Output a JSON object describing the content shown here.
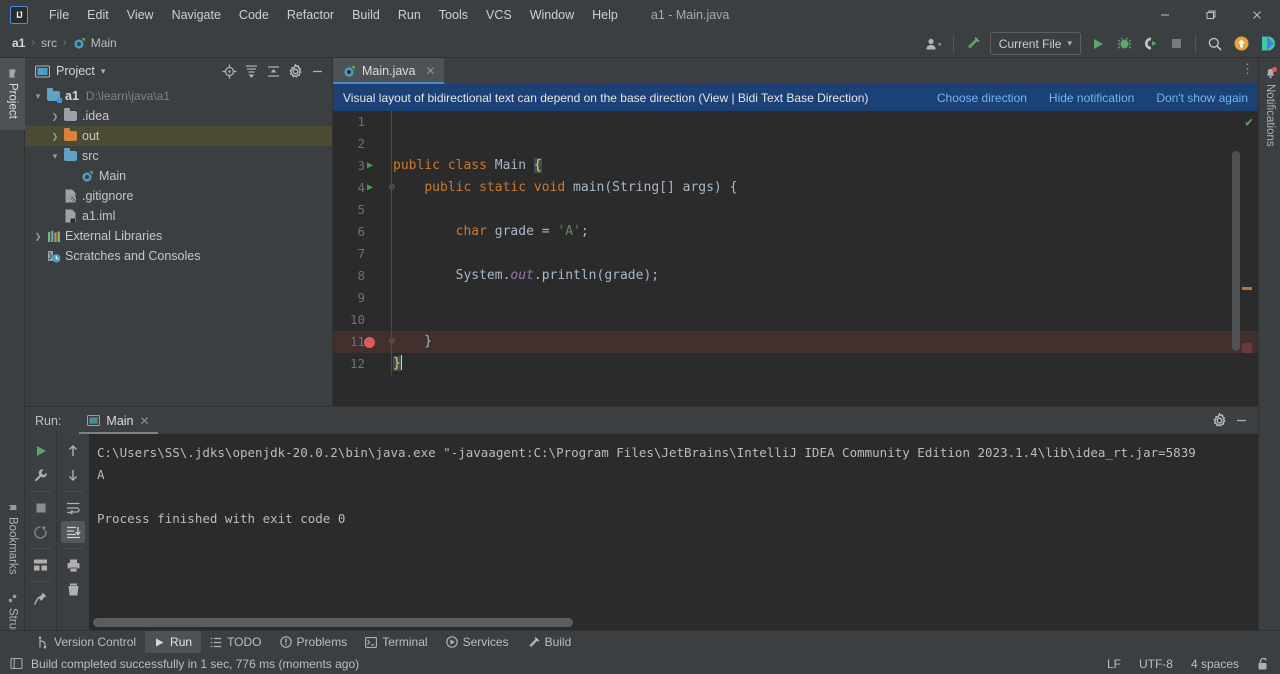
{
  "window": {
    "title": "a1 - Main.java",
    "logo_text": "IJ",
    "minimize": "—",
    "maximize": "❐",
    "close": "✕"
  },
  "menu": {
    "items": [
      {
        "label": "File"
      },
      {
        "label": "Edit"
      },
      {
        "label": "View"
      },
      {
        "label": "Navigate"
      },
      {
        "label": "Code"
      },
      {
        "label": "Refactor"
      },
      {
        "label": "Build"
      },
      {
        "label": "Run"
      },
      {
        "label": "Tools"
      },
      {
        "label": "VCS"
      },
      {
        "label": "Window"
      },
      {
        "label": "Help"
      }
    ]
  },
  "navbar": {
    "crumbs": [
      "a1",
      "src",
      "Main"
    ],
    "separator": "›",
    "run_config": "Current File",
    "chevron": "▾",
    "icons": {
      "account": "account-icon",
      "build_hammer": "build-hammer-icon",
      "run": "run-icon",
      "debug": "debug-icon",
      "run_coverage": "run-with-coverage-icon",
      "stop": "stop-icon",
      "search": "search-icon",
      "update": "update-icon",
      "ide_assistant": "ide-assistant-icon"
    }
  },
  "left_strip": {
    "tabs": [
      {
        "label": "Project",
        "active": true
      },
      {
        "label": "Bookmarks",
        "active": false
      },
      {
        "label": "Structure",
        "active": false
      }
    ]
  },
  "right_strip": {
    "tabs": [
      {
        "label": "Notifications",
        "has_badge": true
      }
    ]
  },
  "project_panel": {
    "title": "Project",
    "dropdown": "▾",
    "actions": [
      "locate-icon",
      "expand-all-icon",
      "collapse-all-icon",
      "settings-icon",
      "hide-icon"
    ],
    "tree": [
      {
        "label": "a1",
        "path": "D:\\learn\\java\\a1",
        "icon": "module-folder",
        "arrow": "open",
        "indent": 0,
        "bold": true
      },
      {
        "label": ".idea",
        "path": "",
        "icon": "folder-grey",
        "arrow": "closed",
        "indent": 1,
        "bold": false
      },
      {
        "label": "out",
        "path": "",
        "icon": "folder-orange",
        "arrow": "closed",
        "indent": 1,
        "bold": false,
        "selected": true
      },
      {
        "label": "src",
        "path": "",
        "icon": "folder-blue",
        "arrow": "open",
        "indent": 1,
        "bold": false
      },
      {
        "label": "Main",
        "path": "",
        "icon": "java-class",
        "arrow": "none",
        "indent": 2,
        "bold": false
      },
      {
        "label": ".gitignore",
        "path": "",
        "icon": "gitignore-file",
        "arrow": "none",
        "indent": 1,
        "bold": false
      },
      {
        "label": "a1.iml",
        "path": "",
        "icon": "iml-file",
        "arrow": "none",
        "indent": 1,
        "bold": false
      },
      {
        "label": "External Libraries",
        "path": "",
        "icon": "libraries",
        "arrow": "closed",
        "indent": 0,
        "bold": false
      },
      {
        "label": "Scratches and Consoles",
        "path": "",
        "icon": "scratches",
        "arrow": "none",
        "indent": 0,
        "bold": false
      }
    ]
  },
  "editor": {
    "tab": {
      "label": "Main.java",
      "icon": "java-class-icon",
      "close": "✕"
    },
    "more_actions": "⋮",
    "notification": {
      "message": "Visual layout of bidirectional text can depend on the base direction (View | Bidi Text Base Direction)",
      "links": [
        "Choose direction",
        "Hide notification",
        "Don't show again"
      ]
    },
    "inspection_status": "✔",
    "lines": [
      {
        "num": "1",
        "tokens": []
      },
      {
        "num": "2",
        "tokens": []
      },
      {
        "num": "3",
        "run_marker": true,
        "tokens": [
          {
            "t": "public",
            "c": "k"
          },
          {
            "t": " ",
            "c": "punc"
          },
          {
            "t": "class",
            "c": "k"
          },
          {
            "t": " Main ",
            "c": "cls"
          },
          {
            "t": "{",
            "c": "brace-hl"
          }
        ]
      },
      {
        "num": "4",
        "run_marker": true,
        "fold": true,
        "tokens": [
          {
            "t": "    ",
            "c": "punc"
          },
          {
            "t": "public",
            "c": "k"
          },
          {
            "t": " ",
            "c": "punc"
          },
          {
            "t": "static",
            "c": "k"
          },
          {
            "t": " ",
            "c": "punc"
          },
          {
            "t": "void",
            "c": "k"
          },
          {
            "t": " ",
            "c": "punc"
          },
          {
            "t": "main",
            "c": "cls"
          },
          {
            "t": "(String[] args) {",
            "c": "punc"
          }
        ]
      },
      {
        "num": "5",
        "tokens": []
      },
      {
        "num": "6",
        "tokens": [
          {
            "t": "        ",
            "c": "punc"
          },
          {
            "t": "char",
            "c": "k"
          },
          {
            "t": " grade = ",
            "c": "punc"
          },
          {
            "t": "'A'",
            "c": "str"
          },
          {
            "t": ";",
            "c": "punc"
          }
        ]
      },
      {
        "num": "7",
        "tokens": []
      },
      {
        "num": "8",
        "tokens": [
          {
            "t": "        System.",
            "c": "punc"
          },
          {
            "t": "out",
            "c": "fld"
          },
          {
            "t": ".println(grade);",
            "c": "punc"
          }
        ]
      },
      {
        "num": "9",
        "tokens": []
      },
      {
        "num": "10",
        "tokens": []
      },
      {
        "num": "11",
        "error": true,
        "breakpoint": true,
        "fold_end": true,
        "bulb": true,
        "tokens": [
          {
            "t": "    }",
            "c": "punc"
          }
        ]
      },
      {
        "num": "12",
        "caret": true,
        "tokens": [
          {
            "t": "}",
            "c": "brace-hl"
          }
        ]
      }
    ]
  },
  "run_window": {
    "label": "Run:",
    "tab": {
      "label": "Main",
      "icon": "console-icon",
      "close": "✕"
    },
    "actions": [
      "settings-icon",
      "hide-icon"
    ],
    "toolbar_left": [
      "rerun-icon",
      "wrench-icon",
      "stop-icon",
      "rerun-failed-icon",
      "layout-icon",
      "pin-icon"
    ],
    "toolbar_right": [
      "scroll-up-icon",
      "scroll-down-icon",
      "soft-wrap-icon",
      "scroll-to-end-icon",
      "print-icon",
      "trash-icon"
    ],
    "console_lines": [
      "C:\\Users\\SS\\.jdks\\openjdk-20.0.2\\bin\\java.exe \"-javaagent:C:\\Program Files\\JetBrains\\IntelliJ IDEA Community Edition 2023.1.4\\lib\\idea_rt.jar=5839",
      "A",
      "",
      "Process finished with exit code 0"
    ]
  },
  "bottom_bar": {
    "items": [
      {
        "label": "Version Control",
        "icon": "branch-icon",
        "active": false
      },
      {
        "label": "Run",
        "icon": "run-icon",
        "active": true
      },
      {
        "label": "TODO",
        "icon": "todo-icon",
        "active": false
      },
      {
        "label": "Problems",
        "icon": "problems-icon",
        "active": false
      },
      {
        "label": "Terminal",
        "icon": "terminal-icon",
        "active": false
      },
      {
        "label": "Services",
        "icon": "services-icon",
        "active": false
      },
      {
        "label": "Build",
        "icon": "build-hammer-icon",
        "active": false
      }
    ]
  },
  "status_bar": {
    "icon": "layout-icon",
    "message": "Build completed successfully in 1 sec, 776 ms (moments ago)",
    "line_ending": "LF",
    "encoding": "UTF-8",
    "indent": "4 spaces",
    "lock_icon": "unlocked-icon"
  },
  "colors": {
    "bg_panel": "#3c3f41",
    "bg_editor": "#2b2b2b",
    "accent_blue": "#4a88c7",
    "notify_bg": "#1b4176",
    "link": "#75b5f0",
    "keyword": "#cc7832",
    "string": "#6a8759",
    "field": "#9876aa",
    "plain": "#a9b7c6",
    "error_line": "#42302f",
    "breakpoint": "#db5c5c",
    "run_green": "#499c54",
    "selected_row": "#4c4a32"
  }
}
